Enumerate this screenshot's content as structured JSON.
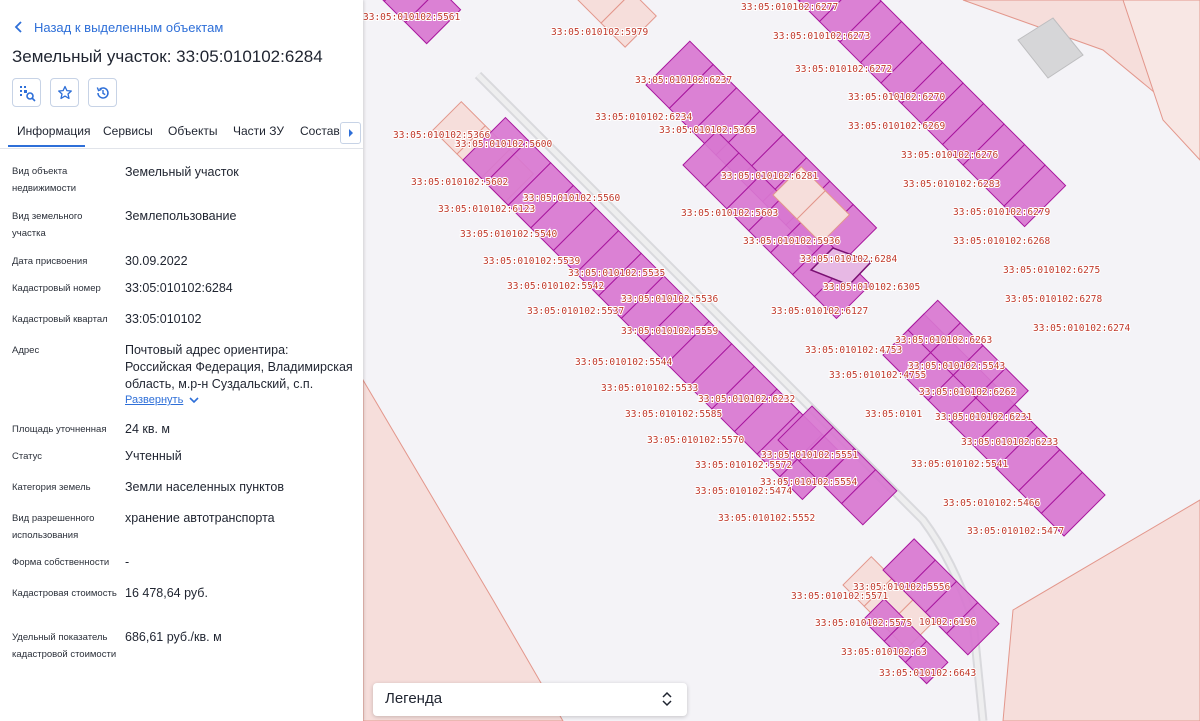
{
  "panel": {
    "back_label": "Назад к выделенным объектам",
    "title": "Земельный участок: 33:05:010102:6284",
    "tabs": [
      {
        "label": "Информация"
      },
      {
        "label": "Сервисы"
      },
      {
        "label": "Объекты"
      },
      {
        "label": "Части ЗУ"
      },
      {
        "label": "Состав"
      }
    ],
    "fields": [
      {
        "label": "Вид объекта недвижимости",
        "value": "Земельный участок"
      },
      {
        "label": "Вид земельного участка",
        "value": "Землепользование"
      },
      {
        "label": "Дата присвоения",
        "value": "30.09.2022"
      },
      {
        "label": "Кадастровый номер",
        "value": "33:05:010102:6284"
      },
      {
        "label": "Кадастровый квартал",
        "value": "33:05:010102"
      },
      {
        "label": "Адрес",
        "value": "Почтовый адрес ориентира: Российская Федерация, Владимирская область, м.р-н Суздальский, с.п."
      },
      {
        "label": "Площадь уточненная",
        "value": "24 кв. м"
      },
      {
        "label": "Статус",
        "value": "Учтенный"
      },
      {
        "label": "Категория земель",
        "value": "Земли населенных пунктов"
      },
      {
        "label": "Вид разрешенного использования",
        "value": "хранение автотранспорта"
      },
      {
        "label": "Форма собственности",
        "value": "-"
      },
      {
        "label": "Кадастровая стоимость",
        "value": "16 478,64 руб."
      },
      {
        "label": "Удельный показатель кадастровой стоимости",
        "value": "686,61 руб./кв. м"
      }
    ],
    "expand_label": "Развернуть"
  },
  "map": {
    "parcel_labels": [
      "33:05:010102:5561",
      "33:05:010102:5979",
      "33:05:010102:6277",
      "33:05:010102:6273",
      "33:05:010102:6272",
      "33:05:010102:6270",
      "33:05:010102:6269",
      "33:05:010102:6276",
      "33:05:010102:6283",
      "33:05:010102:6279",
      "33:05:010102:6268",
      "33:05:010102:6275",
      "33:05:010102:6278",
      "33:05:010102:6274",
      "33:05:010102:6237",
      "33:05:010102:6234",
      "33:05:010102:5365",
      "33:05:010102:5366",
      "33:05:010102:5600",
      "33:05:010102:5602",
      "33:05:010102:6123",
      "33:05:010102:5560",
      "33:05:010102:6281",
      "33:05:010102:5603",
      "33:05:010102:5540",
      "33:05:010102:5936",
      "33:05:010102:5539",
      "33:05:010102:6284",
      "33:05:010102:5535",
      "33:05:010102:6305",
      "33:05:010102:5542",
      "33:05:010102:5536",
      "33:05:010102:5537",
      "33:05:010102:6127",
      "33:05:010102:5559",
      "33:05:010102:6263",
      "33:05:010102:4753",
      "33:05:010102:5544",
      "33:05:010102:5543",
      "33:05:010102:4755",
      "33:05:010102:5533",
      "33:05:010102:6262",
      "33:05:010102:6232",
      "33:05:0101",
      "33:05:010102:6231",
      "33:05:010102:5585",
      "33:05:010102:6233",
      "33:05:010102:5570",
      "33:05:010102:5551",
      "33:05:010102:5541",
      "33:05:010102:5572",
      "33:05:010102:5554",
      "33:05:010102:5474",
      "33:05:010102:5466",
      "33:05:010102:5552",
      "33:05:010102:5477",
      "33:05:010102:5556",
      "33:05:010102:5571",
      "33:05:010102:5575",
      "10102:6196",
      "33:05:010102:63",
      "33:05:010102:6643"
    ],
    "colors": {
      "parcel_fill": "#d877d0",
      "parcel_stroke": "#a8179e",
      "light_parcel_fill": "#f6dedb",
      "light_parcel_stroke": "#e3978c",
      "label_color": "#c0392b",
      "background": "#f4f3f7"
    }
  },
  "legend": {
    "label": "Легенда"
  }
}
